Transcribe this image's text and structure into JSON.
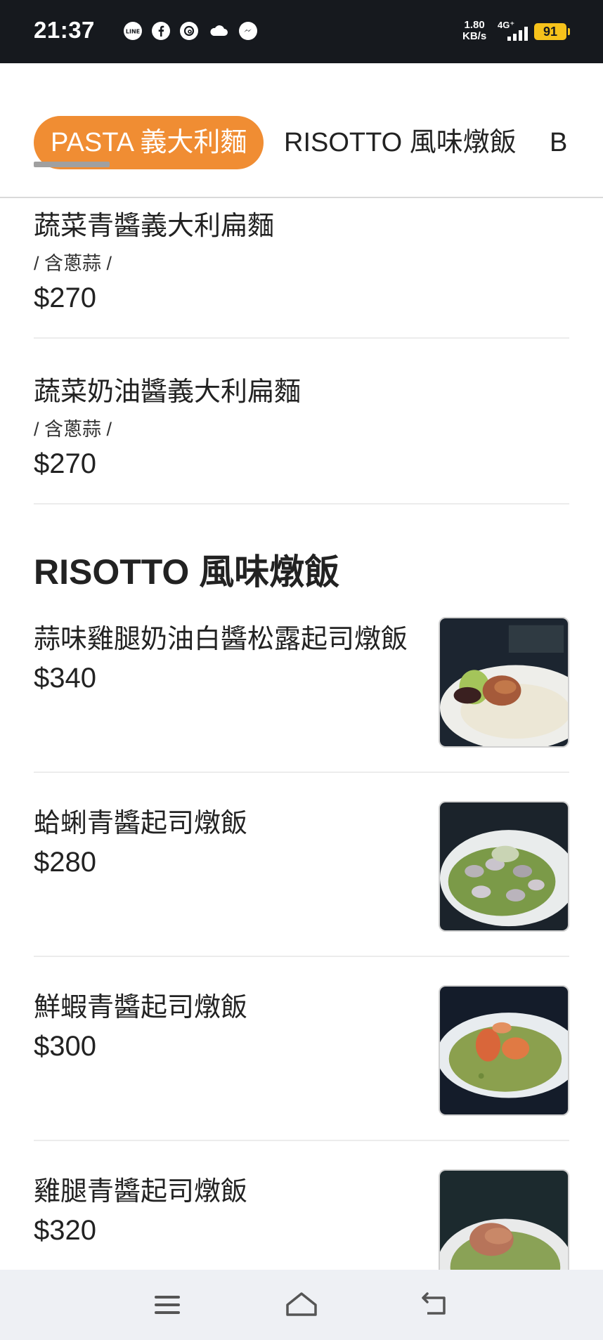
{
  "status_bar": {
    "time": "21:37",
    "app_icons": [
      "line-icon",
      "facebook-icon",
      "threads-icon",
      "cloud-icon",
      "messenger-icon"
    ],
    "net_speed_value": "1.80",
    "net_speed_unit": "KB/s",
    "network": "4G⁺",
    "battery": "91",
    "battery_color": "#f6c21b"
  },
  "tabs": [
    {
      "label": "PASTA 義大利麵",
      "active": true
    },
    {
      "label": "RISOTTO 風味燉飯",
      "active": false
    },
    {
      "label": "B",
      "active": false
    }
  ],
  "accent_color": "#f08d33",
  "pasta_items": [
    {
      "name": "蔬菜青醬義大利扁麵",
      "note": "/ 含蔥蒜 /",
      "price": "$270"
    },
    {
      "name": "蔬菜奶油醬義大利扁麵",
      "note": "/ 含蔥蒜 /",
      "price": "$270"
    }
  ],
  "risotto_section": {
    "title": "RISOTTO 風味燉飯",
    "items": [
      {
        "name": "蒜味雞腿奶油白醬松露起司燉飯",
        "price": "$340",
        "image": "risotto-chicken-cream-photo"
      },
      {
        "name": "蛤蜊青醬起司燉飯",
        "price": "$280",
        "image": "risotto-clam-pesto-photo"
      },
      {
        "name": "鮮蝦青醬起司燉飯",
        "price": "$300",
        "image": "risotto-shrimp-pesto-photo"
      },
      {
        "name": "雞腿青醬起司燉飯",
        "price": "$320",
        "image": "risotto-chicken-pesto-photo"
      }
    ]
  },
  "nav_bar": {
    "buttons": [
      "menu-icon",
      "home-icon",
      "back-icon"
    ]
  }
}
